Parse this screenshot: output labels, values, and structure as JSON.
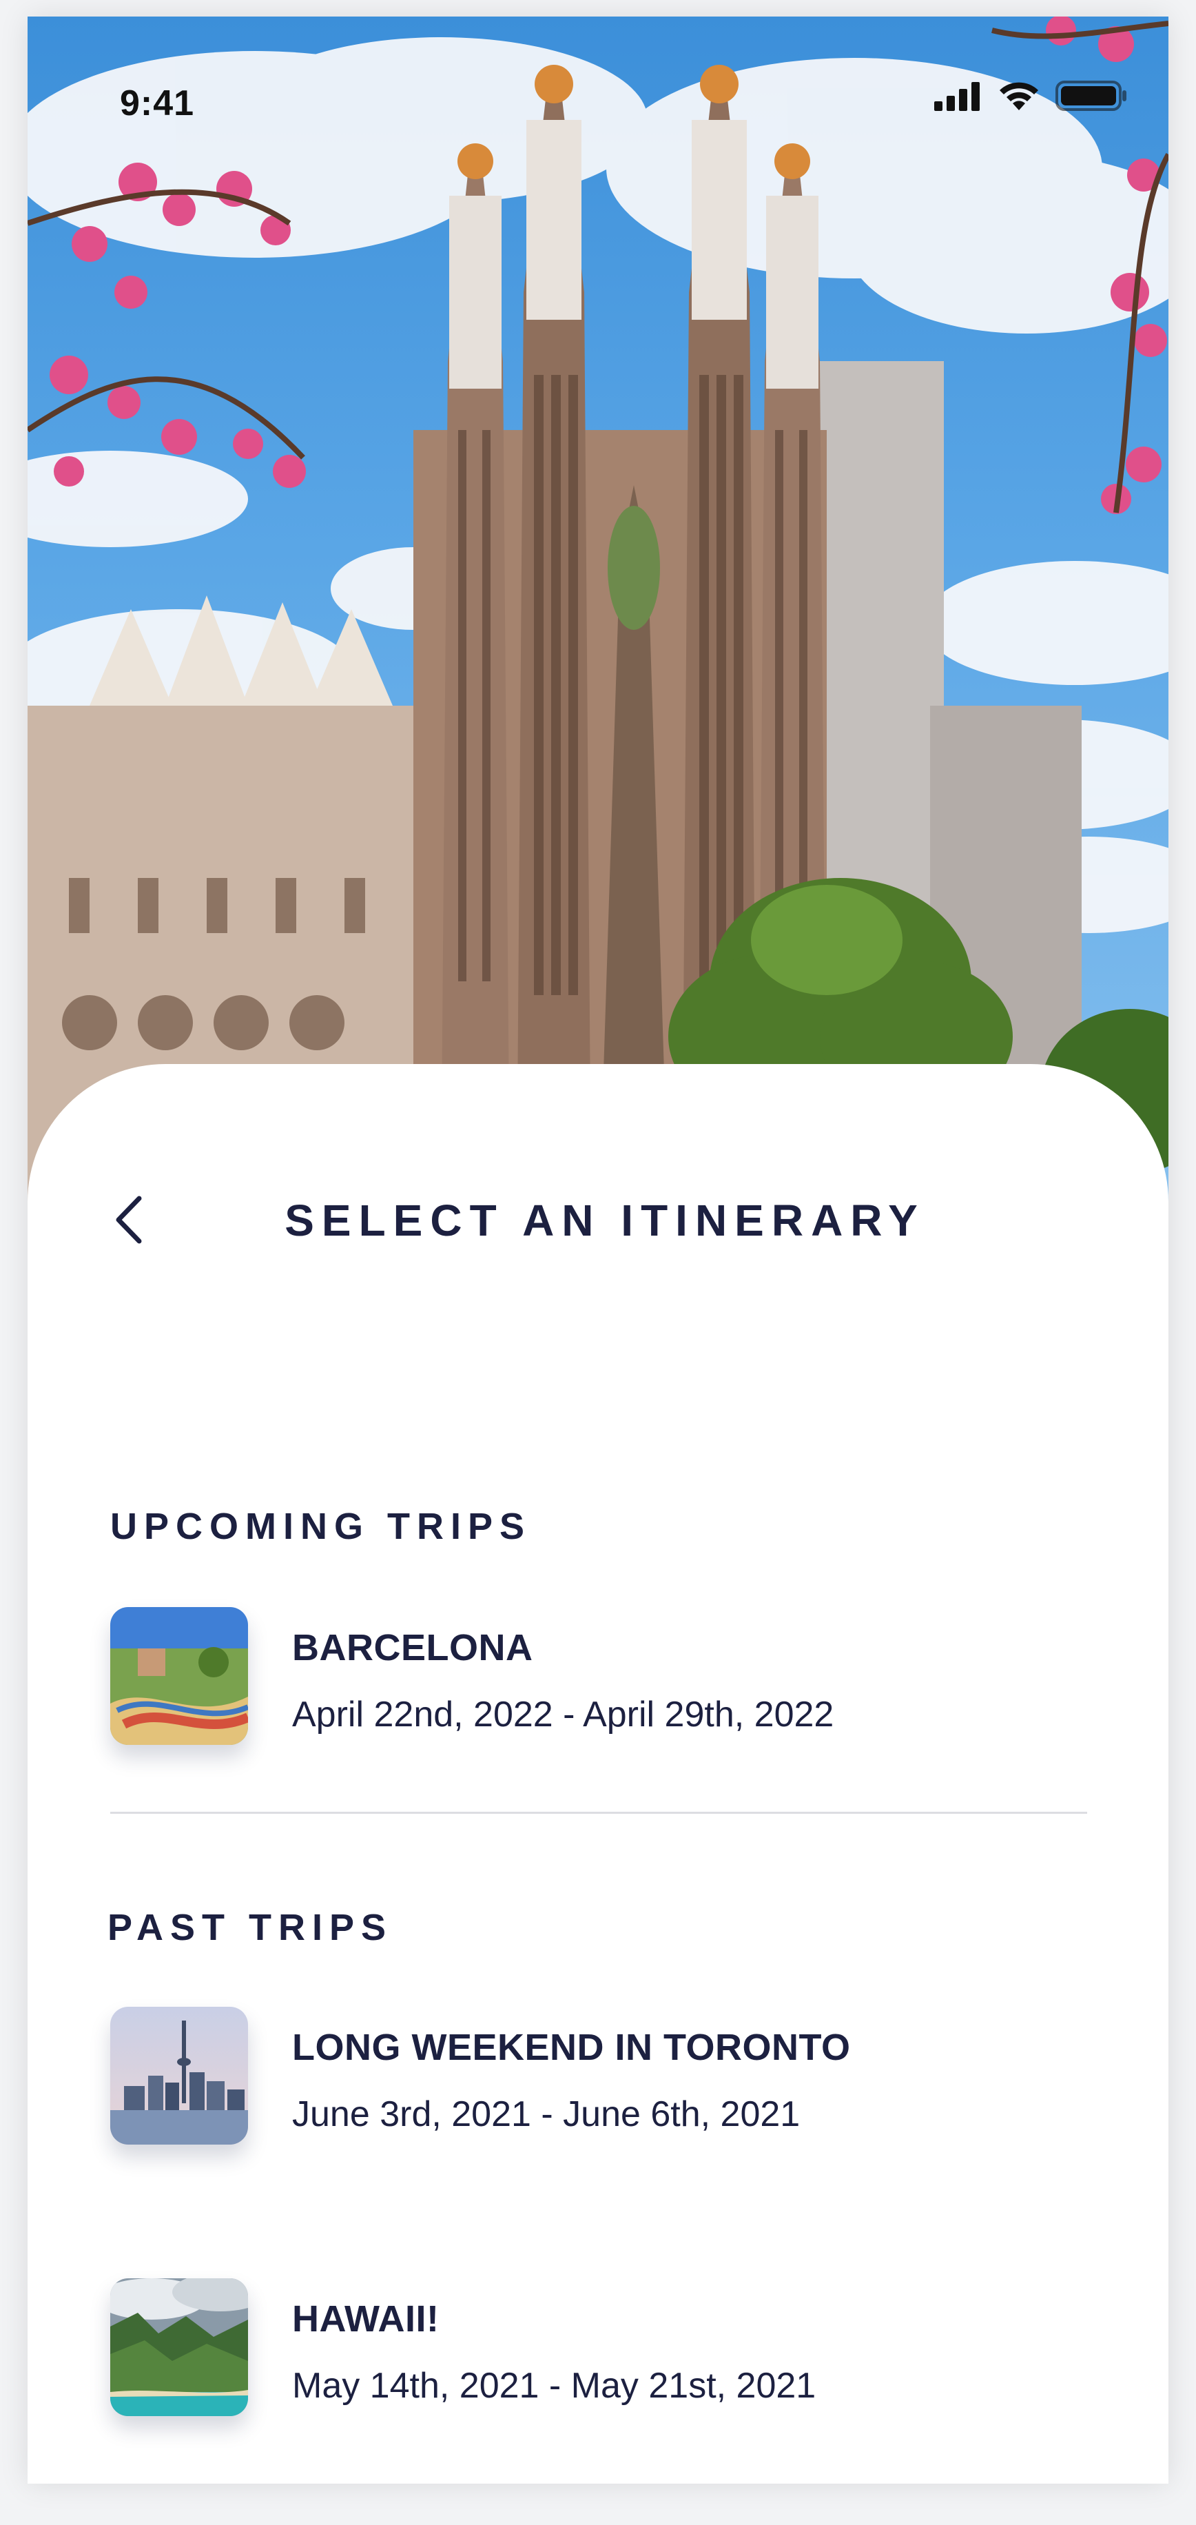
{
  "status_bar": {
    "time": "9:41"
  },
  "header": {
    "title": "SELECT AN ITINERARY",
    "back_icon": "chevron-left-icon"
  },
  "sections": {
    "upcoming": {
      "label": "UPCOMING TRIPS",
      "trips": [
        {
          "name": "BARCELONA",
          "dates": "April 22nd, 2022 - April 29th, 2022"
        }
      ]
    },
    "past": {
      "label": "PAST TRIPS",
      "trips": [
        {
          "name": "LONG WEEKEND IN TORONTO",
          "dates": "June 3rd, 2021 - June 6th, 2021"
        },
        {
          "name": "HAWAII!",
          "dates": "May 14th, 2021 - May 21st, 2021"
        }
      ]
    }
  },
  "colors": {
    "text": "#1c2040",
    "divider": "#dcdde2",
    "sky": "#4a9ae0",
    "stone": "#9a7a66"
  }
}
